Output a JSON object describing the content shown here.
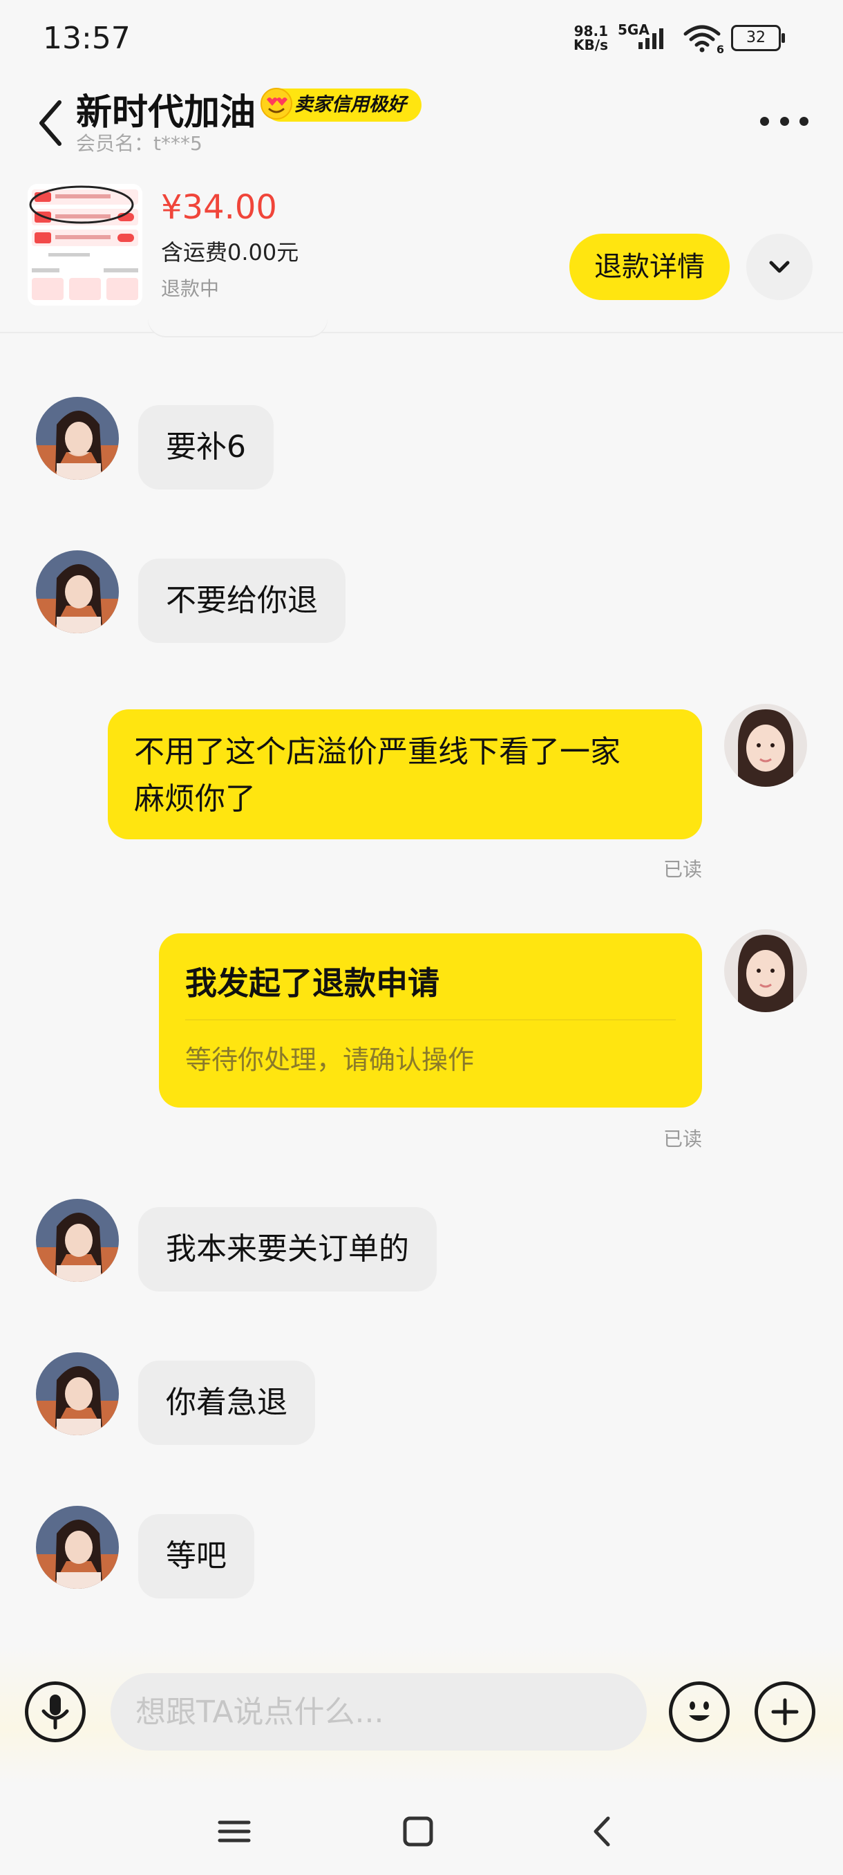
{
  "status_bar": {
    "time": "13:57",
    "net_speed_value": "98.1",
    "net_speed_unit": "KB/s",
    "network": "5GA",
    "wifi_label": "6",
    "battery": "32"
  },
  "header": {
    "seller_name": "新时代加油",
    "credit_badge": "卖家信用极好",
    "member_label": "会员名：t***5"
  },
  "product": {
    "price": "¥34.00",
    "shipping": "含运费0.00元",
    "status": "退款中",
    "refund_button": "退款详情"
  },
  "messages": [
    {
      "from": "seller",
      "text": "要补6"
    },
    {
      "from": "seller",
      "text": "不要给你退"
    },
    {
      "from": "me",
      "text_line1": "不用了这个店溢价严重线下看了一家",
      "text_line2": "麻烦你了",
      "read": "已读"
    },
    {
      "from": "me",
      "type": "refund_card",
      "title": "我发起了退款申请",
      "subtitle": "等待你处理，请确认操作",
      "read": "已读"
    },
    {
      "from": "seller",
      "text": "我本来要关订单的"
    },
    {
      "from": "seller",
      "text": "你着急退"
    },
    {
      "from": "seller",
      "text": "等吧"
    }
  ],
  "input": {
    "placeholder": "想跟TA说点什么..."
  },
  "icons": {
    "back": "back-arrow-icon",
    "more": "more-dots-icon",
    "expand": "chevron-down-icon",
    "voice": "microphone-icon",
    "emoji": "emoji-icon",
    "add": "plus-icon"
  },
  "colors": {
    "accent": "#ffe510",
    "price": "#f0453a",
    "incoming_bubble": "#ededed"
  }
}
